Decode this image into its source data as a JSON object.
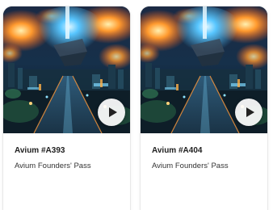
{
  "cards": [
    {
      "title": "Avium #A393",
      "collection": "Avium Founders' Pass",
      "media_icon": "play-icon"
    },
    {
      "title": "Avium #A404",
      "collection": "Avium Founders' Pass",
      "media_icon": "play-icon"
    }
  ],
  "colors": {
    "card_bg": "#ffffff",
    "title_text": "#1f1f1f",
    "subtitle_text": "#333333",
    "play_button_bg": "#ffffff",
    "play_icon": "#222222"
  }
}
